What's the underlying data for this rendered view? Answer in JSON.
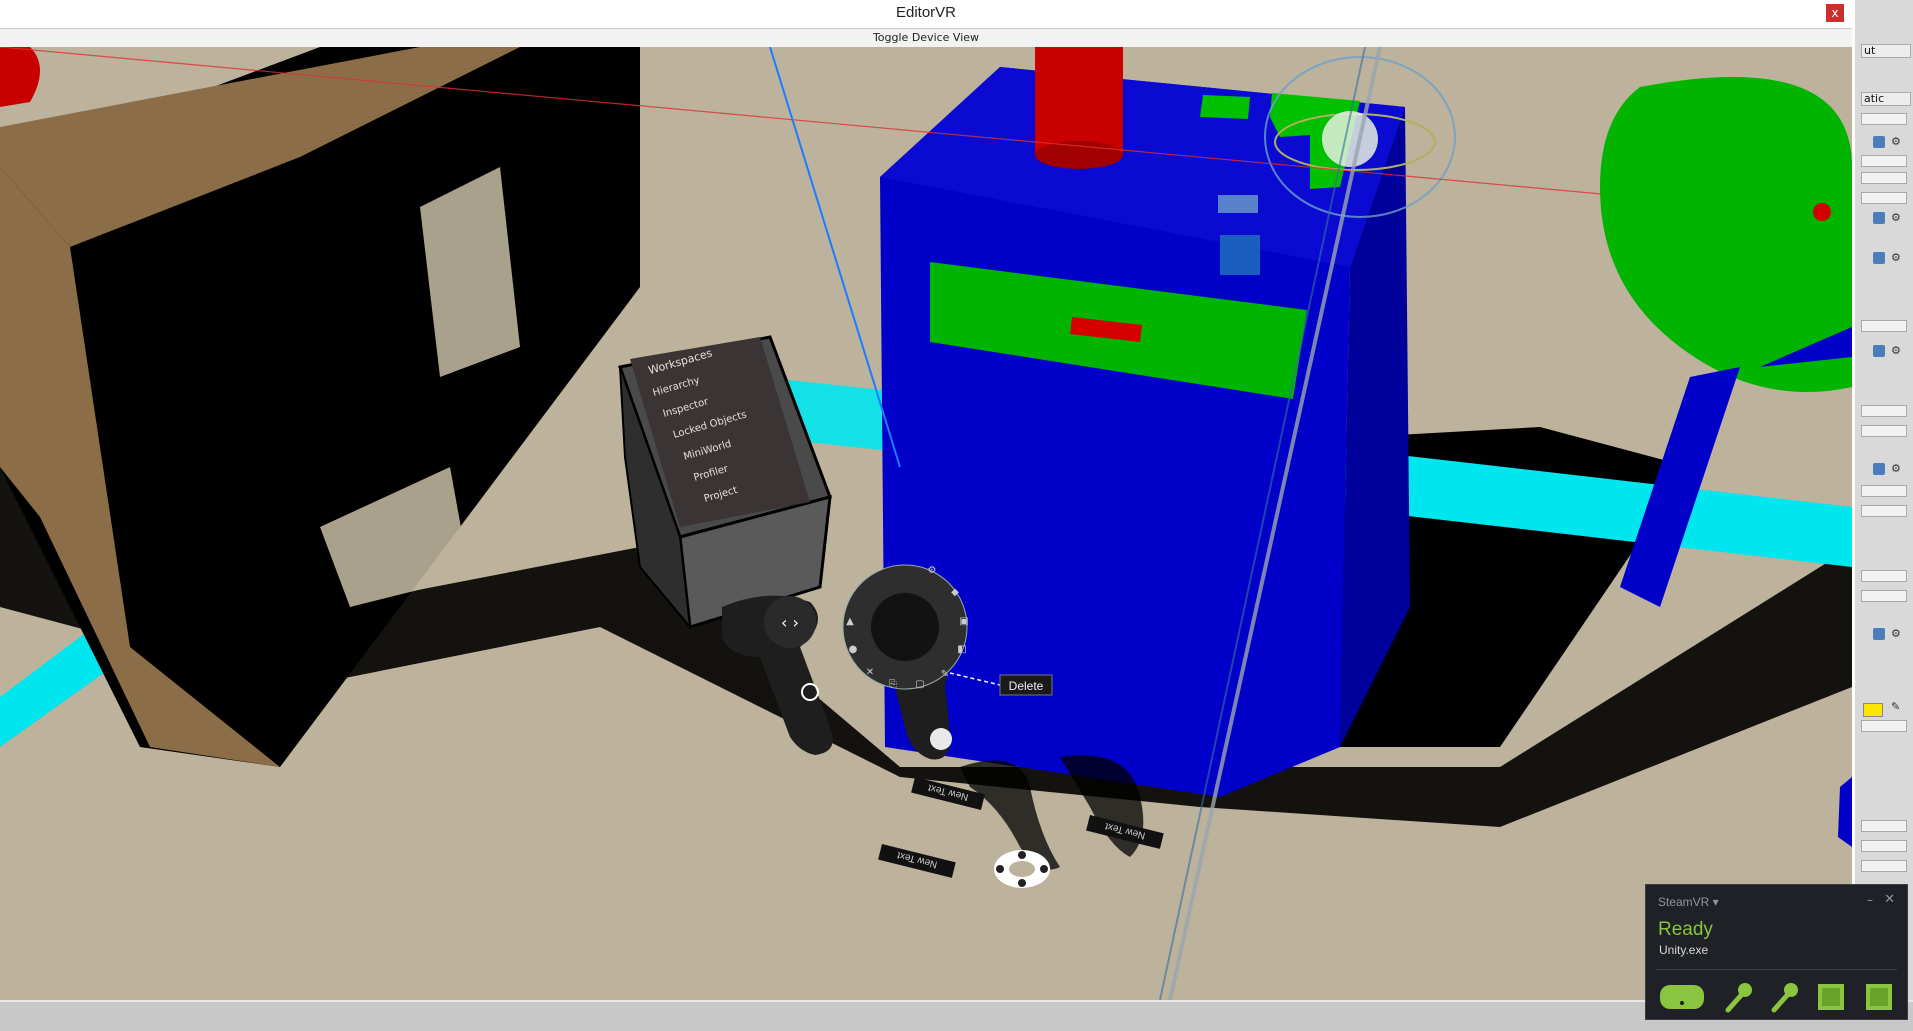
{
  "window": {
    "title": "EditorVR",
    "close_label": "x",
    "toggle_label": "Toggle Device View"
  },
  "workspaces_menu": {
    "title": "Workspaces",
    "items": [
      "Hierarchy",
      "Inspector",
      "Locked Objects",
      "MiniWorld",
      "Profiler",
      "Project"
    ]
  },
  "radial_menu": {
    "tooltip": "Delete"
  },
  "floor_labels": [
    "New Text",
    "New Text",
    "New Text"
  ],
  "right_panel": {
    "dropdown_1": "ut",
    "dropdown_2": "atic"
  },
  "steamvr": {
    "header": "SteamVR ▾",
    "status": "Ready",
    "app": "Unity.exe",
    "minimize": "–",
    "close": "✕",
    "devices": [
      "headset-icon",
      "controller-icon",
      "controller-icon",
      "base-station-icon",
      "base-station-icon"
    ],
    "accent": "#8bc53f"
  },
  "colors": {
    "cube_blue": "#0000c8",
    "green": "#00b400",
    "red": "#c80000",
    "cyan": "#00e6ee",
    "floor": "#bdb29c"
  }
}
